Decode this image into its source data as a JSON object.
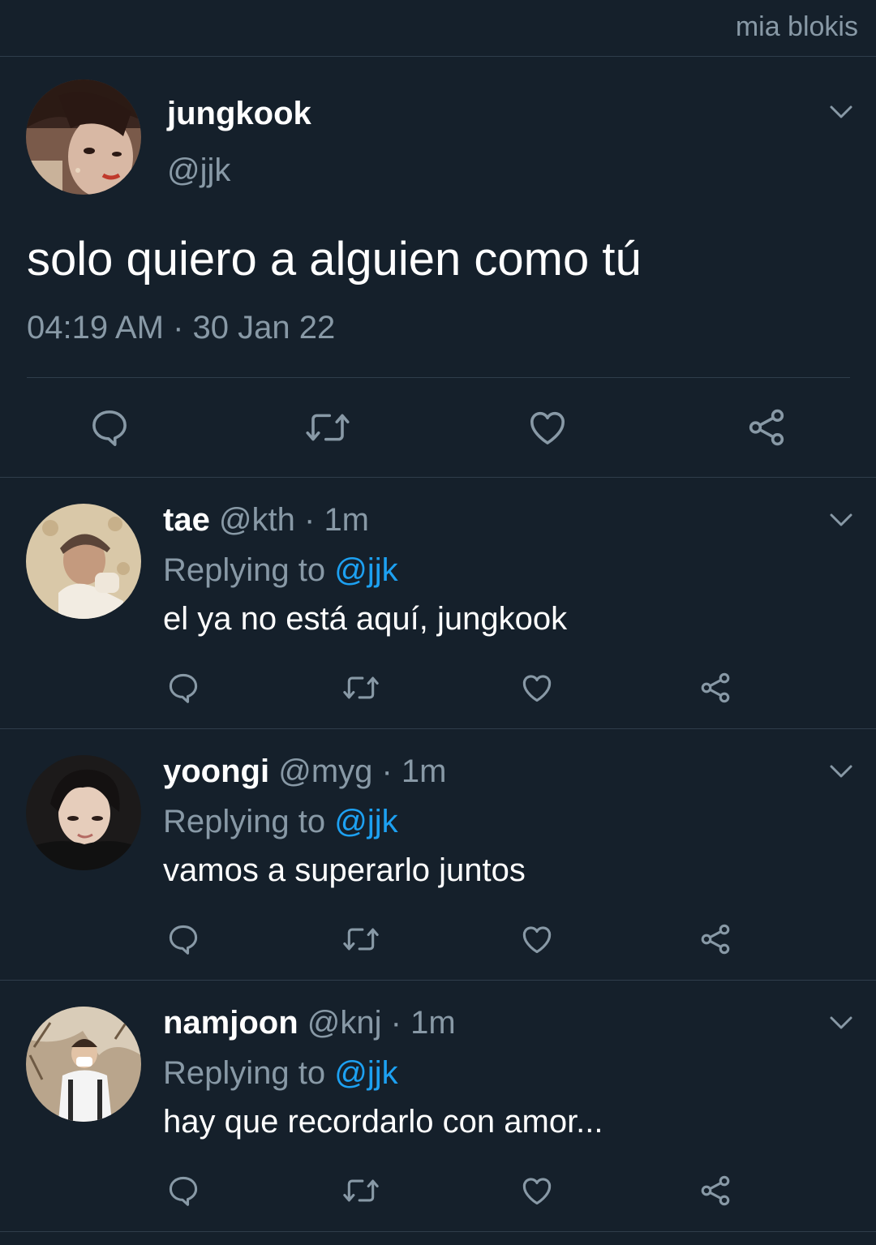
{
  "watermark": "mia blokis",
  "main_tweet": {
    "name": "jungkook",
    "handle": "@jjk",
    "text": "solo quiero a alguien como tú",
    "timestamp": "04:19 AM · 30 Jan 22",
    "avatar": "avatar-photo",
    "menu_icon": "chevron-down-icon",
    "actions": [
      "reply-icon",
      "retweet-icon",
      "like-icon",
      "share-icon"
    ]
  },
  "replies": [
    {
      "name": "tae",
      "meta": " @kth · 1m",
      "replying_label": "Replying to ",
      "replying_to": "@jjk",
      "text": "el ya no está aquí, jungkook"
    },
    {
      "name": "yoongi",
      "meta": " @myg · 1m",
      "replying_label": "Replying to ",
      "replying_to": "@jjk",
      "text": "vamos a superarlo juntos"
    },
    {
      "name": "namjoon",
      "meta": " @knj · 1m",
      "replying_label": "Replying to ",
      "replying_to": "@jjk",
      "text": "hay que recordarlo con amor..."
    }
  ],
  "colors": {
    "background": "#15202b",
    "secondary_text": "#8899a6",
    "accent": "#1da1f2",
    "divider": "#2f3d4b"
  }
}
